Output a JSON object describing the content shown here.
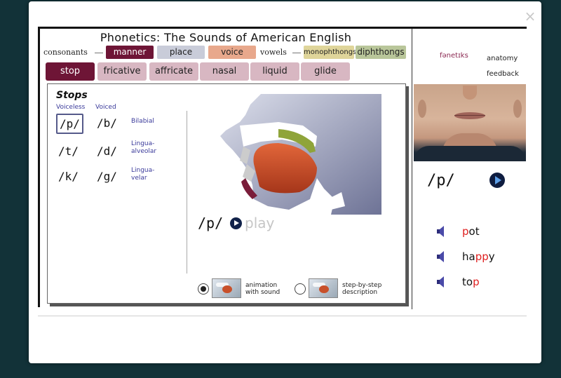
{
  "window": {
    "close_glyph": "×"
  },
  "title": "Phonetics:  The Sounds of American English",
  "nav": {
    "consonants_label": "consonants",
    "vowels_label": "vowels",
    "consonant_tabs": [
      "manner",
      "place",
      "voice"
    ],
    "vowel_tabs": [
      "monophthongs",
      "diphthongs"
    ],
    "manner_tabs": [
      "stop",
      "fricative",
      "affricate",
      "nasal",
      "liquid",
      "glide"
    ],
    "active_manner": "stop"
  },
  "stops": {
    "title": "Stops",
    "col_voiceless": "Voiceless",
    "col_voiced": "Voiced",
    "rows": [
      {
        "voiceless": "/p/",
        "voiced": "/b/",
        "place_line1": "Bilabial",
        "place_line2": ""
      },
      {
        "voiceless": "/t/",
        "voiced": "/d/",
        "place_line1": "Lingua-",
        "place_line2": "alveolar"
      },
      {
        "voiceless": "/k/",
        "voiced": "/g/",
        "place_line1": "Lingua-",
        "place_line2": "velar"
      }
    ],
    "selected": "/p/"
  },
  "player": {
    "phoneme": "/p/",
    "play_label": "play"
  },
  "options": {
    "animation_line1": "animation",
    "animation_line2": "with sound",
    "step_line1": "step-by-step",
    "step_line2": "description",
    "selected": "animation"
  },
  "right_panel": {
    "phonetic_link": "fənetɪks",
    "anatomy_link": "anatomy",
    "feedback_link": "feedback",
    "phoneme": "/p/",
    "words": [
      {
        "pre": "",
        "hl": "p",
        "post": "ot"
      },
      {
        "pre": "ha",
        "hl": "pp",
        "post": "y"
      },
      {
        "pre": "to",
        "hl": "p",
        "post": ""
      }
    ]
  },
  "colors": {
    "maroon": "#6e1536",
    "place": "#c9ccd9",
    "voice": "#e8a88c",
    "mono": "#dfd59a",
    "diph": "#b9c69a",
    "highlight": "#e02020",
    "background": "#123238"
  },
  "icons": {
    "close": "close-icon",
    "play": "play-icon",
    "speaker": "speaker-icon"
  }
}
